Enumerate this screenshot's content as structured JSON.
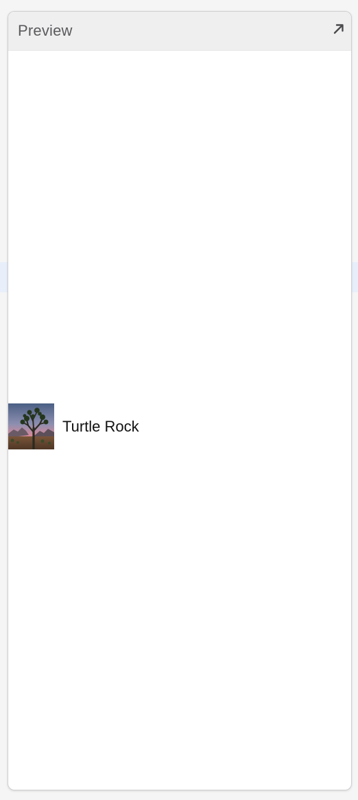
{
  "panel": {
    "title": "Preview",
    "expand_icon": "arrow-up-right-icon"
  },
  "list": {
    "items": [
      {
        "name": "Turtle Rock",
        "thumbnail": "landscape-thumbnail-image"
      }
    ]
  },
  "colors": {
    "background": "#f5f5f6",
    "header_bg": "#efefef",
    "title_text": "#5b5b5e",
    "row_text": "#111111",
    "selection_band": "#e8effb"
  }
}
